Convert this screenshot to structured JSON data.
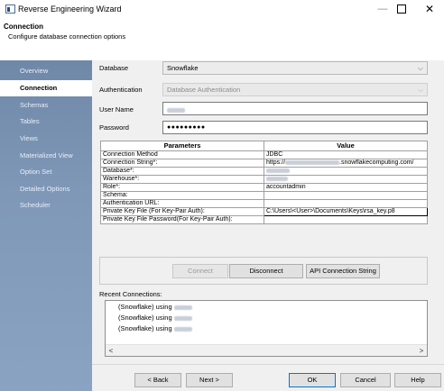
{
  "window": {
    "title": "Reverse Engineering Wizard",
    "minimize": "—",
    "close": "✕"
  },
  "header": {
    "title": "Connection",
    "subtitle": "Configure database connection options"
  },
  "sidebar": {
    "items": [
      {
        "label": "Overview"
      },
      {
        "label": "Connection"
      },
      {
        "label": "Schemas"
      },
      {
        "label": "Tables"
      },
      {
        "label": "Views"
      },
      {
        "label": "Materialized View"
      },
      {
        "label": "Option Set"
      },
      {
        "label": "Detailed Options"
      },
      {
        "label": "Scheduler"
      }
    ],
    "active_index": 1
  },
  "form": {
    "database_label": "Database",
    "database_value": "Snowflake",
    "authentication_label": "Authentication",
    "authentication_value": "Database Authentication",
    "username_label": "User Name",
    "username_value": "",
    "password_label": "Password",
    "password_value": "●●●●●●●●●"
  },
  "params": {
    "header_param": "Parameters",
    "header_value": "Value",
    "rows": [
      {
        "name": "Connection Method",
        "value": "JDBC"
      },
      {
        "name": "Connection String*:",
        "value": "https://",
        "value_suffix": ".snowflakecomputing.com/"
      },
      {
        "name": "Database*:",
        "value": ""
      },
      {
        "name": "Warehouse*:",
        "value": ""
      },
      {
        "name": "Role*:",
        "value": "accountadmin"
      },
      {
        "name": "Schema:",
        "value": ""
      },
      {
        "name": "Authentication URL:",
        "value": ""
      },
      {
        "name": "Private Key File (For Key-Pair Auth):",
        "value": "C:\\Users\\<User>\\Documents\\Keys\\rsa_key.p8"
      },
      {
        "name": "Private Key File Password(For Key-Pair Auth):",
        "value": ""
      }
    ]
  },
  "actions": {
    "connect": "Connect",
    "disconnect": "Disconnect",
    "api_connection_string": "API Connection String"
  },
  "recent": {
    "label": "Recent Connections:",
    "items": [
      {
        "text": "(Snowflake) using"
      },
      {
        "text": "(Snowflake) using"
      },
      {
        "text": "(Snowflake) using"
      }
    ]
  },
  "footer": {
    "back": "< Back",
    "next": "Next >",
    "ok": "OK",
    "cancel": "Cancel",
    "help": "Help"
  },
  "colors": {
    "sidebar": "#7f98b8",
    "primary_border": "#0078d7"
  }
}
